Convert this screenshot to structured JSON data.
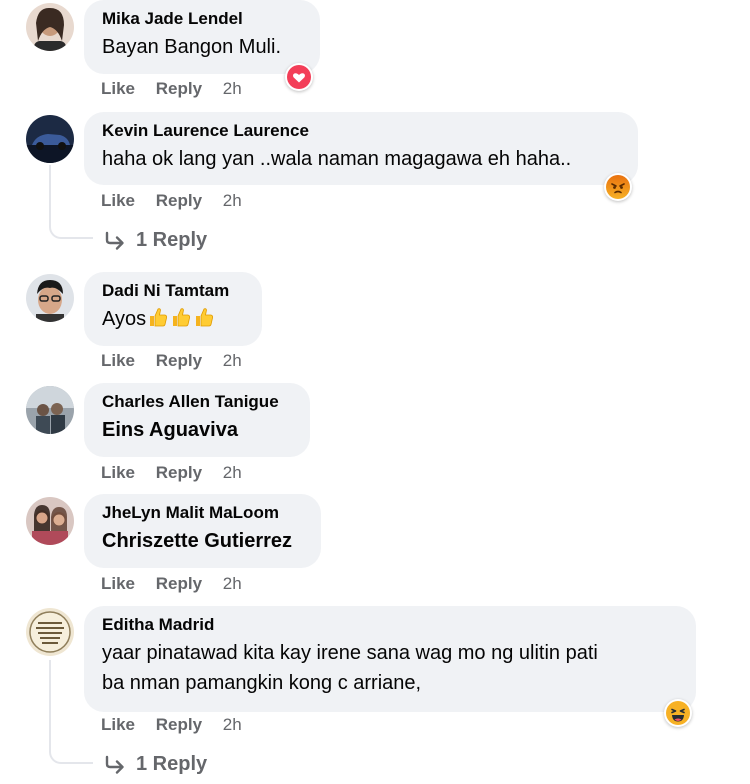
{
  "comments": [
    {
      "author": "Mika Jade Lendel",
      "text": "Bayan Bangon Muli.",
      "actions": {
        "like": "Like",
        "reply": "Reply",
        "time": "2h"
      },
      "reaction": "heart-reaction-icon"
    },
    {
      "author": "Kevin Laurence Laurence",
      "text": "haha ok lang yan ..wala naman magagawa eh haha..",
      "actions": {
        "like": "Like",
        "reply": "Reply",
        "time": "2h"
      },
      "reaction": "angry-reaction-icon",
      "replies_label": "1 Reply"
    },
    {
      "author": "Dadi Ni Tamtam",
      "text": "Ayos",
      "emojis": [
        "thumbs-up-icon",
        "thumbs-up-icon",
        "thumbs-up-icon"
      ],
      "actions": {
        "like": "Like",
        "reply": "Reply",
        "time": "2h"
      }
    },
    {
      "author": "Charles Allen Tanigue",
      "text": "Eins Aguaviva",
      "actions": {
        "like": "Like",
        "reply": "Reply",
        "time": "2h"
      }
    },
    {
      "author": "JheLyn Malit MaLoom",
      "text": "Chriszette Gutierrez",
      "actions": {
        "like": "Like",
        "reply": "Reply",
        "time": "2h"
      }
    },
    {
      "author": "Editha Madrid",
      "text_line1": "yaar pinatawad kita kay irene sana wag mo ng ulitin pati",
      "text_line2": "ba nman pamangkin kong c arriane,",
      "actions": {
        "like": "Like",
        "reply": "Reply",
        "time": "2h"
      },
      "reaction": "haha-reaction-icon",
      "replies_label": "1 Reply"
    }
  ],
  "colors": {
    "bubble": "#f0f2f5",
    "secondary_text": "#65676b",
    "heart": "#f33e58",
    "angry": "#e9710f",
    "haha": "#f7b125"
  }
}
